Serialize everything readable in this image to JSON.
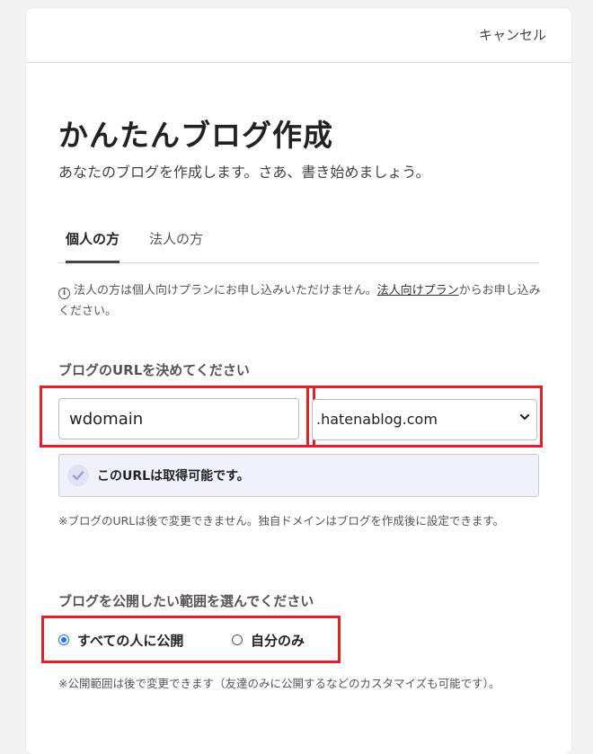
{
  "header": {
    "cancel_label": "キャンセル"
  },
  "page": {
    "title": "かんたんブログ作成",
    "subtitle": "あなたのブログを作成します。さあ、書き始めましょう。"
  },
  "tabs": [
    {
      "label": "個人の方",
      "active": true
    },
    {
      "label": "法人の方",
      "active": false
    }
  ],
  "notice": {
    "icon": "info-icon",
    "text_before": "法人の方は個人向けプランにお申し込みいただけません。",
    "link_text": "法人向けプラン",
    "text_after": "からお申し込みください。"
  },
  "url_section": {
    "label": "ブログのURLを決めてください",
    "subdomain_value": "wdomain",
    "domain_selected": ".hatenablog.com",
    "availability_message": "このURLは取得可能です。",
    "note": "※ブログのURLは後で変更できません。独自ドメインはブログを作成後に設定できます。"
  },
  "visibility_section": {
    "label": "ブログを公開したい範囲を選んでください",
    "options": [
      {
        "label": "すべての人に公開",
        "checked": true
      },
      {
        "label": "自分のみ",
        "checked": false
      }
    ],
    "note": "※公開範囲は後で変更できます（友達のみに公開するなどのカスタマイズも可能です）。"
  },
  "colors": {
    "highlight_border": "#e0202a",
    "radio_accent": "#1a73e8",
    "availability_bg": "#f0f1fb"
  }
}
